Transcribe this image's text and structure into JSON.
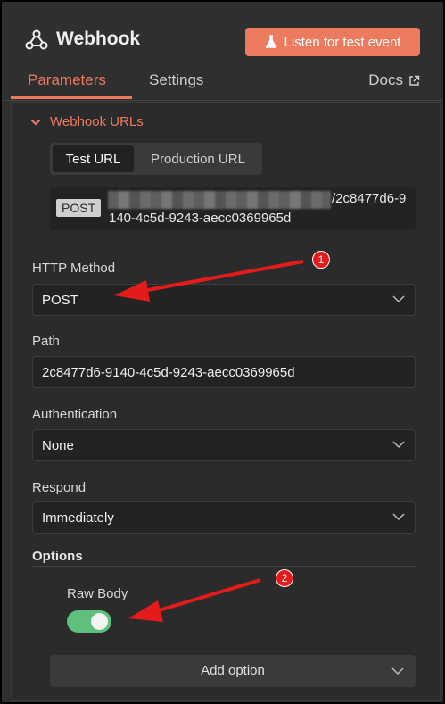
{
  "node": {
    "title": "Webhook",
    "icon": "webhook-icon"
  },
  "listen_button": {
    "label": "Listen for test event",
    "icon": "flask-icon"
  },
  "tabs": [
    {
      "label": "Parameters",
      "active": true
    },
    {
      "label": "Settings",
      "active": false
    }
  ],
  "docs": {
    "label": "Docs",
    "icon": "external-link-icon"
  },
  "webhook_urls": {
    "label": "Webhook URLs",
    "segments": [
      {
        "label": "Test URL",
        "active": true
      },
      {
        "label": "Production URL",
        "active": false
      }
    ],
    "method_badge": "POST",
    "url_line1": "/2c8477d6-9",
    "url_line2": "140-4c5d-9243-aecc0369965d"
  },
  "fields": {
    "http_method": {
      "label": "HTTP Method",
      "value": "POST"
    },
    "path": {
      "label": "Path",
      "value": "2c8477d6-9140-4c5d-9243-aecc0369965d"
    },
    "authentication": {
      "label": "Authentication",
      "value": "None"
    },
    "respond": {
      "label": "Respond",
      "value": "Immediately"
    }
  },
  "options": {
    "title": "Options",
    "raw_body": {
      "label": "Raw Body",
      "enabled": true
    }
  },
  "add_option": {
    "label": "Add option"
  },
  "annotations": [
    {
      "number": "1"
    },
    {
      "number": "2"
    }
  ],
  "colors": {
    "accent": "#ec7a5f",
    "background": "#2f2f2f",
    "toggle_on": "#5ec07a",
    "annotation": "#e31b1b"
  }
}
